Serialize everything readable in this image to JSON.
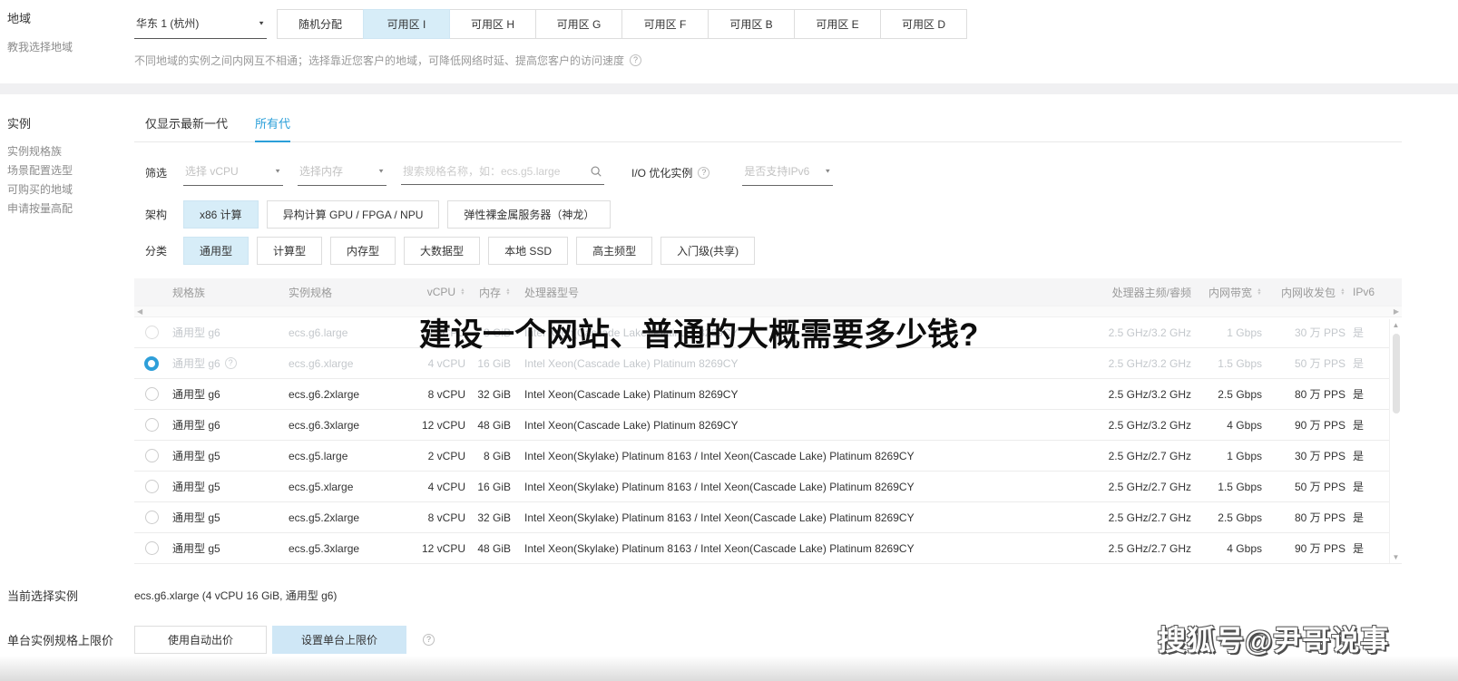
{
  "region": {
    "label": "地域",
    "help_link": "教我选择地域",
    "selected": "华东 1 (杭州)",
    "random_button": "随机分配",
    "zones": [
      "可用区 I",
      "可用区 H",
      "可用区 G",
      "可用区 F",
      "可用区 B",
      "可用区 E",
      "可用区 D"
    ],
    "selected_zone": "可用区 I",
    "note": "不同地域的实例之间内网互不相通；选择靠近您客户的地域，可降低网络时延、提高您客户的访问速度"
  },
  "instance": {
    "label": "实例",
    "sidebar_links": [
      "实例规格族",
      "场景配置选型",
      "可购买的地域",
      "申请按量高配"
    ],
    "tabs": [
      {
        "label": "仅显示最新一代",
        "active": false
      },
      {
        "label": "所有代",
        "active": true
      }
    ],
    "filter": {
      "label": "筛选",
      "vcpu_placeholder": "选择 vCPU",
      "memory_placeholder": "选择内存",
      "search_placeholder": "搜索规格名称，如：ecs.g5.large",
      "io_label": "I/O 优化实例",
      "ipv6_placeholder": "是否支持IPv6"
    },
    "arch": {
      "label": "架构",
      "options": [
        "x86 计算",
        "异构计算 GPU / FPGA / NPU",
        "弹性裸金属服务器（神龙）"
      ],
      "selected": "x86 计算"
    },
    "category": {
      "label": "分类",
      "options": [
        "通用型",
        "计算型",
        "内存型",
        "大数据型",
        "本地 SSD",
        "高主频型",
        "入门级(共享)"
      ],
      "selected": "通用型"
    }
  },
  "table": {
    "headers": [
      "规格族",
      "实例规格",
      "vCPU",
      "内存",
      "处理器型号",
      "处理器主频/睿频",
      "内网带宽",
      "内网收发包",
      "IPv6"
    ],
    "sortable": [
      "vCPU",
      "内存",
      "内网带宽",
      "内网收发包"
    ],
    "rows": [
      {
        "family": "通用型 g6",
        "spec": "ecs.g6.large",
        "vcpu": "2 vCPU",
        "mem": "8 GiB",
        "cpu": "Intel Xeon(Cascade Lake) Platinum 8269CY",
        "freq": "2.5 GHz/3.2 GHz",
        "bw": "1 Gbps",
        "pps": "30 万 PPS",
        "ipv6": "是",
        "dimmed": true,
        "selected": false,
        "has_help": false
      },
      {
        "family": "通用型 g6",
        "spec": "ecs.g6.xlarge",
        "vcpu": "4 vCPU",
        "mem": "16 GiB",
        "cpu": "Intel Xeon(Cascade Lake) Platinum 8269CY",
        "freq": "2.5 GHz/3.2 GHz",
        "bw": "1.5 Gbps",
        "pps": "50 万 PPS",
        "ipv6": "是",
        "dimmed": true,
        "selected": true,
        "has_help": true
      },
      {
        "family": "通用型 g6",
        "spec": "ecs.g6.2xlarge",
        "vcpu": "8 vCPU",
        "mem": "32 GiB",
        "cpu": "Intel Xeon(Cascade Lake) Platinum 8269CY",
        "freq": "2.5 GHz/3.2 GHz",
        "bw": "2.5 Gbps",
        "pps": "80 万 PPS",
        "ipv6": "是",
        "dimmed": false,
        "selected": false,
        "has_help": false
      },
      {
        "family": "通用型 g6",
        "spec": "ecs.g6.3xlarge",
        "vcpu": "12 vCPU",
        "mem": "48 GiB",
        "cpu": "Intel Xeon(Cascade Lake) Platinum 8269CY",
        "freq": "2.5 GHz/3.2 GHz",
        "bw": "4 Gbps",
        "pps": "90 万 PPS",
        "ipv6": "是",
        "dimmed": false,
        "selected": false,
        "has_help": false
      },
      {
        "family": "通用型 g5",
        "spec": "ecs.g5.large",
        "vcpu": "2 vCPU",
        "mem": "8 GiB",
        "cpu": "Intel Xeon(Skylake) Platinum 8163 / Intel Xeon(Cascade Lake) Platinum 8269CY",
        "freq": "2.5 GHz/2.7 GHz",
        "bw": "1 Gbps",
        "pps": "30 万 PPS",
        "ipv6": "是",
        "dimmed": false,
        "selected": false,
        "has_help": false
      },
      {
        "family": "通用型 g5",
        "spec": "ecs.g5.xlarge",
        "vcpu": "4 vCPU",
        "mem": "16 GiB",
        "cpu": "Intel Xeon(Skylake) Platinum 8163 / Intel Xeon(Cascade Lake) Platinum 8269CY",
        "freq": "2.5 GHz/2.7 GHz",
        "bw": "1.5 Gbps",
        "pps": "50 万 PPS",
        "ipv6": "是",
        "dimmed": false,
        "selected": false,
        "has_help": false
      },
      {
        "family": "通用型 g5",
        "spec": "ecs.g5.2xlarge",
        "vcpu": "8 vCPU",
        "mem": "32 GiB",
        "cpu": "Intel Xeon(Skylake) Platinum 8163 / Intel Xeon(Cascade Lake) Platinum 8269CY",
        "freq": "2.5 GHz/2.7 GHz",
        "bw": "2.5 Gbps",
        "pps": "80 万 PPS",
        "ipv6": "是",
        "dimmed": false,
        "selected": false,
        "has_help": false
      },
      {
        "family": "通用型 g5",
        "spec": "ecs.g5.3xlarge",
        "vcpu": "12 vCPU",
        "mem": "48 GiB",
        "cpu": "Intel Xeon(Skylake) Platinum 8163 / Intel Xeon(Cascade Lake) Platinum 8269CY",
        "freq": "2.5 GHz/2.7 GHz",
        "bw": "4 Gbps",
        "pps": "90 万 PPS",
        "ipv6": "是",
        "dimmed": false,
        "selected": false,
        "has_help": false
      }
    ]
  },
  "footer": {
    "current_label": "当前选择实例",
    "current_value": "ecs.g6.xlarge (4 vCPU 16 GiB, 通用型 g6)",
    "price_label": "单台实例规格上限价",
    "auto_bid_button": "使用自动出价",
    "set_limit_button": "设置单台上限价"
  },
  "overlay": {
    "title": "建设一个网站、普通的大概需要多少钱?",
    "watermark": "搜狐号@尹哥说事"
  },
  "icons": {
    "chevron_down": "▼",
    "sort_up": "▲",
    "sort_down": "▼",
    "scroll_left": "◀",
    "scroll_right": "▶",
    "scroll_up": "▲",
    "scroll_down": "▼",
    "help": "?"
  },
  "colors": {
    "accent": "#2b9fd9",
    "selected_button_bg": "#d7edf8",
    "table_header_bg": "#f5f5f6",
    "dimmed_text": "#c4c8cc",
    "text": "#333333",
    "muted_text": "#8c8c8c"
  }
}
